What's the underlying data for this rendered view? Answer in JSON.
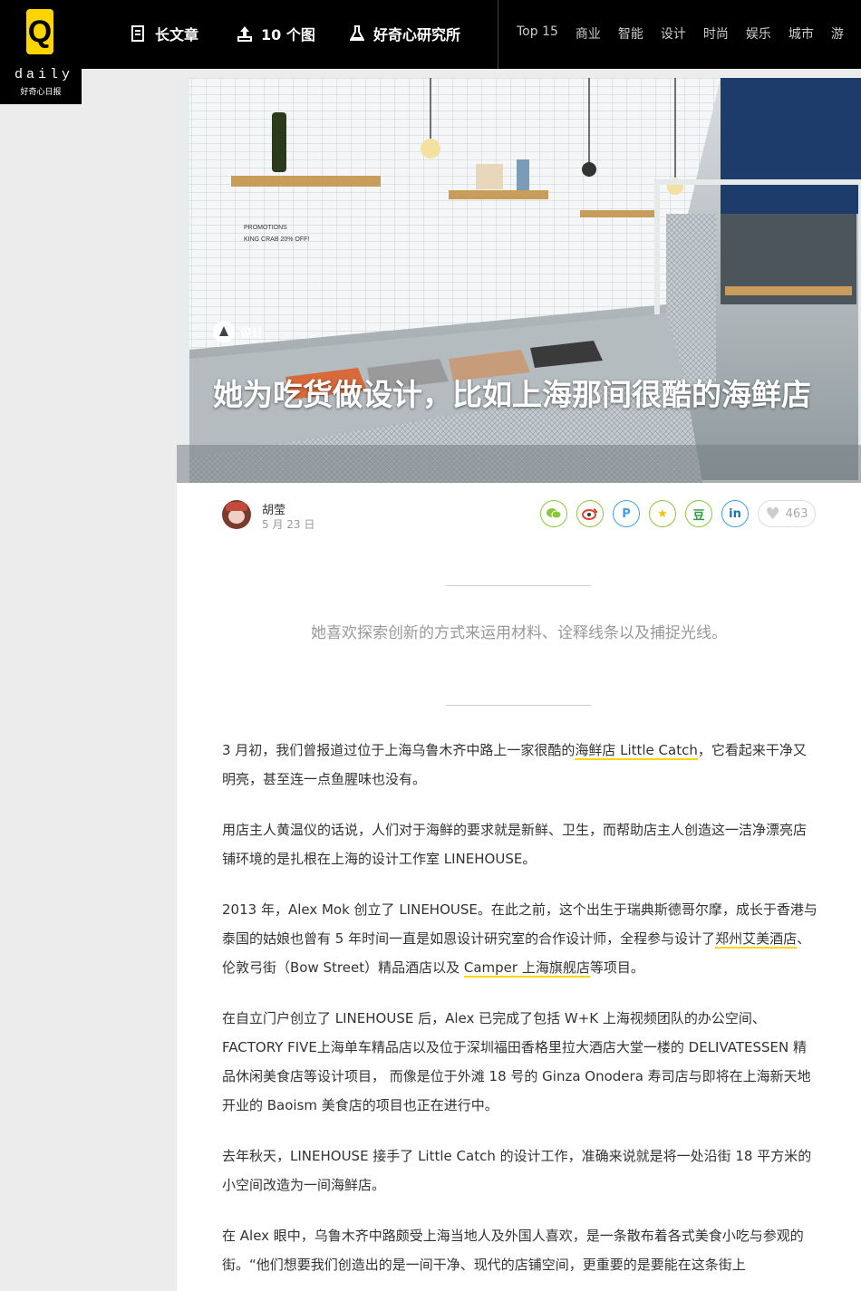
{
  "brand": {
    "mark": "Q",
    "word": "daily",
    "cn": "好奇心日报"
  },
  "nav": {
    "features": [
      {
        "label": "长文章",
        "icon": "document-icon"
      },
      {
        "label": "10 个图",
        "icon": "upload-image-icon"
      },
      {
        "label": "好奇心研究所",
        "icon": "flask-icon"
      }
    ],
    "categories": [
      "Top 15",
      "商业",
      "智能",
      "设计",
      "时尚",
      "娱乐",
      "城市",
      "游"
    ]
  },
  "article": {
    "category": "设计",
    "title": "她为吃货做设计，比如上海那间很酷的海鲜店",
    "author": "胡莹",
    "date": "5 月 23 日",
    "likes": "463",
    "share_icons": [
      "wechat-icon",
      "weibo-icon",
      "pinterest-icon",
      "qzone-star-icon",
      "douban-icon",
      "linkedin-icon"
    ],
    "share_glyphs": {
      "douban": "豆",
      "linkedin": "in",
      "pinterest": "P",
      "star": "★"
    },
    "lead": "她喜欢探索创新的方式来运用材料、诠释线条以及捕捉光线。",
    "hero_text": {
      "promo1": "PROMOTIONS",
      "promo2": "KING CRAB 20% OFF!"
    },
    "p1": {
      "a": "3 月初，我们曾报道过位于上海乌鲁木齐中路上一家很酷的",
      "link": "海鲜店 Little Catch",
      "b": "，它看起来干净又明亮，甚至连一点鱼腥味也没有。"
    },
    "p2": "用店主人黄温仪的话说，人们对于海鲜的要求就是新鲜、卫生，而帮助店主人创造这一洁净漂亮店铺环境的是扎根在上海的设计工作室 LINEHOUSE。",
    "p3": {
      "a": "2013 年，Alex Mok 创立了 LINEHOUSE。在此之前，这个出生于瑞典斯德哥尔摩，成长于香港与泰国的姑娘也曾有 5 年时间一直是如恩设计研究室的合作设计师，全程参与设计了",
      "link1": "郑州艾美酒店",
      "b": "、伦敦弓街（Bow Street）精品酒店以及 ",
      "link2": "Camper 上海旗舰店",
      "c": "等项目。"
    },
    "p4": "在自立门户创立了 LINEHOUSE 后，Alex 已完成了包括 W+K 上海视频团队的办公空间、FACTORY FIVE上海单车精品店以及位于深圳福田香格里拉大酒店大堂一楼的 DELIVATESSEN 精品休闲美食店等设计项目， 而像是位于外滩 18 号的 Ginza Onodera 寿司店与即将在上海新天地开业的 Baoism 美食店的项目也正在进行中。",
    "p5": "去年秋天，LINEHOUSE 接手了  Little Catch 的设计工作，准确来说就是将一处沿街 18 平方米的小空间改造为一间海鲜店。",
    "p6": "在 Alex 眼中，乌鲁木齐中路颇受上海当地人及外国人喜欢，是一条散布着各式美食小吃与参观的街。“他们想要我们创造出的是一间干净、现代的店铺空间，更重要的是要能在这条街上"
  },
  "colors": {
    "accent": "#ffd500",
    "share_green": "#8cc63e",
    "topbar": "#000000"
  }
}
